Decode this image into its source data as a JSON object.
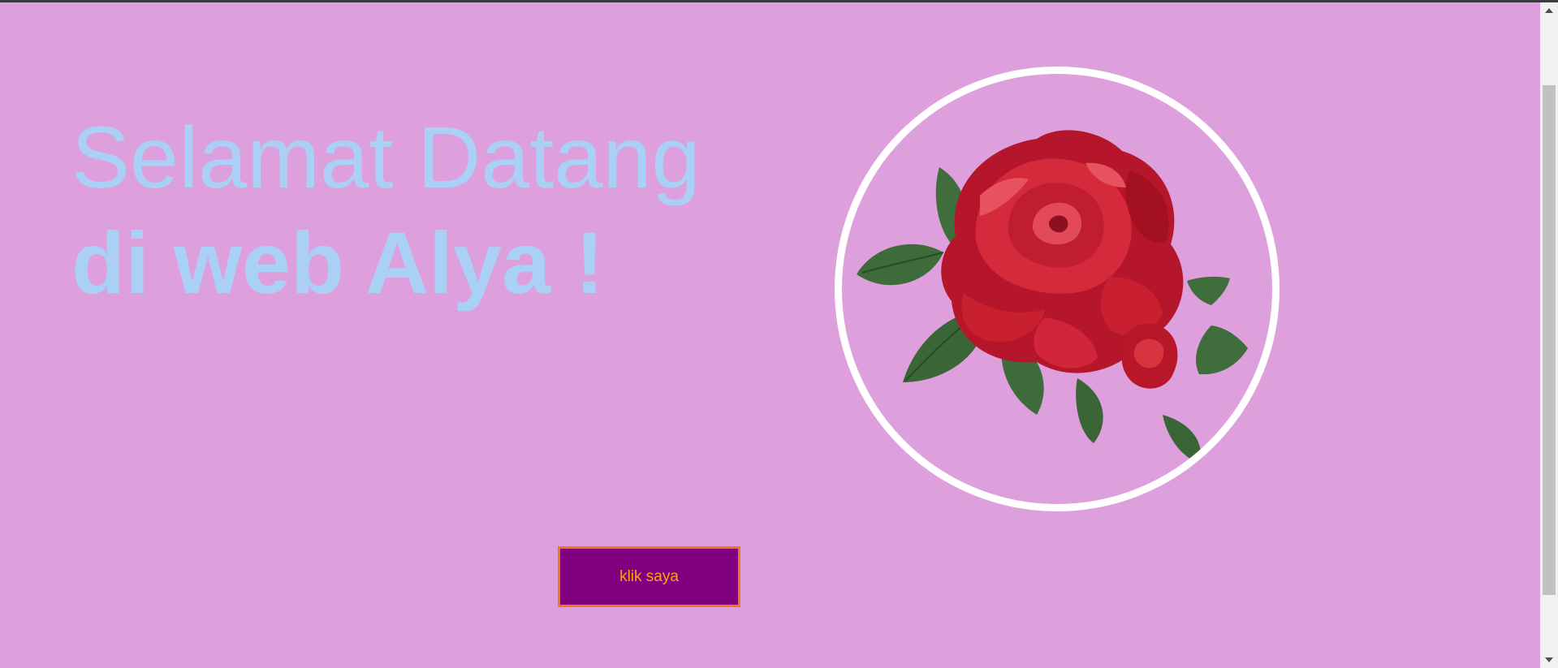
{
  "hero": {
    "line1": "Selamat Datang",
    "line2": "di web Alya !"
  },
  "image": {
    "icon": "rose-image"
  },
  "button": {
    "label": "klik saya"
  },
  "colors": {
    "background": "#dda0dd",
    "title": "#aad0f5",
    "button_bg": "#800080",
    "button_text": "#ffa500",
    "button_border": "#e87a1a",
    "frame_border": "#ffffff"
  }
}
